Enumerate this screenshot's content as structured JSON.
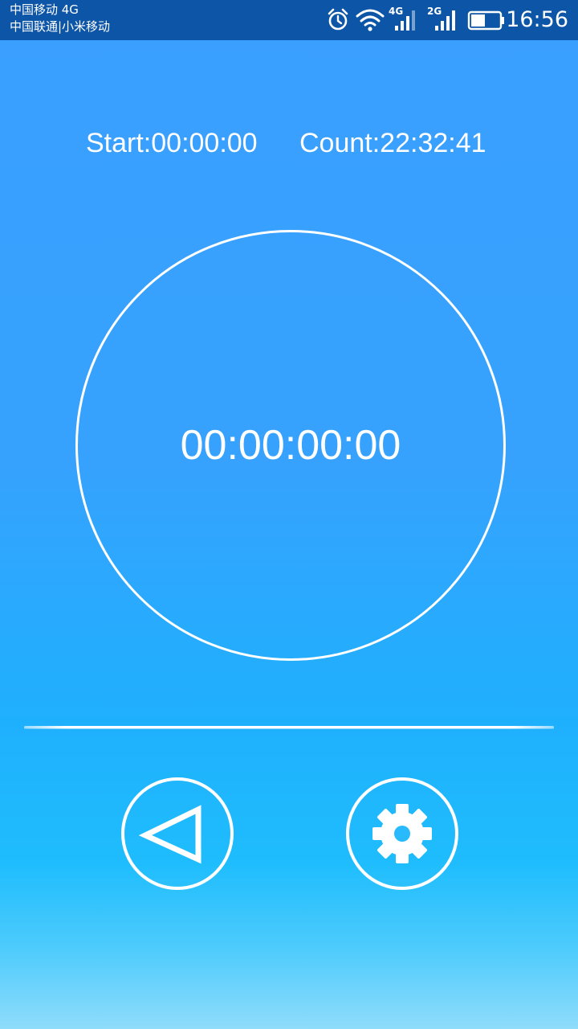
{
  "status_bar": {
    "carrier_1": "中国移动 4G",
    "carrier_2": "中国联通|小米移动",
    "network_1": "4G",
    "network_2": "2G",
    "time": "16:56",
    "battery_level": 0.5,
    "icons": [
      "alarm-clock-icon",
      "wifi-icon",
      "signal-4g-icon",
      "signal-2g-icon",
      "battery-icon"
    ]
  },
  "counters": {
    "start": "Start:00:00:00",
    "count": "Count:22:32:41"
  },
  "timer": {
    "display": "00:00:00:00"
  },
  "controls": {
    "play_icon": "play-icon",
    "settings_icon": "gear-icon"
  },
  "colors": {
    "status_bar": "#0d55a6",
    "background_top": "#3a9fff",
    "background_mid": "#1fb0fd",
    "background_bottom": "#8fdcfb",
    "foreground": "#ffffff"
  }
}
